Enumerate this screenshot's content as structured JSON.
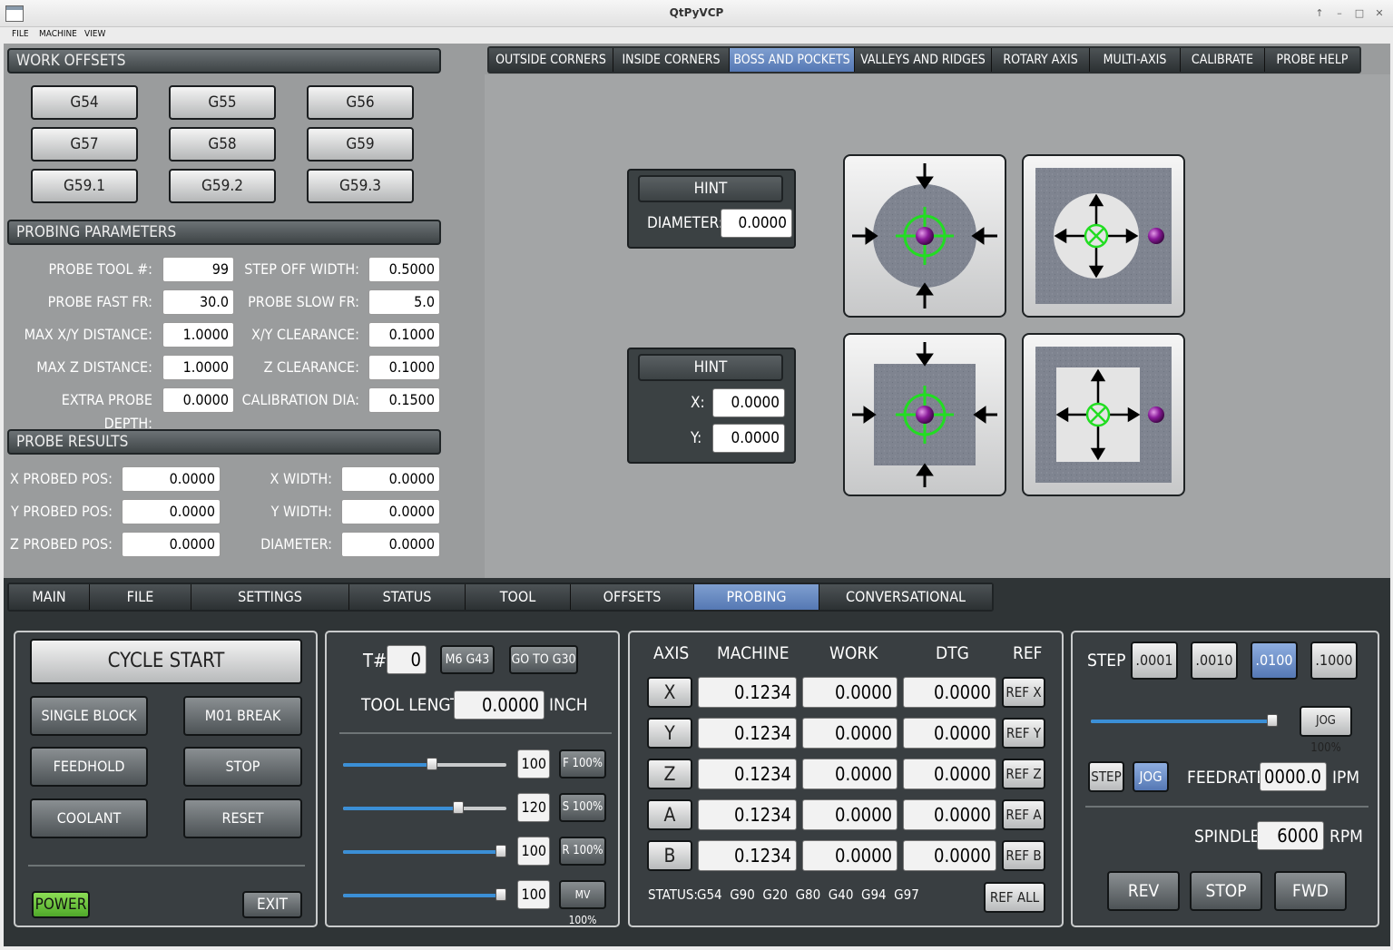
{
  "window": {
    "title": "QtPyVCP"
  },
  "menu": [
    "FILE",
    "MACHINE",
    "VIEW"
  ],
  "work_offsets": {
    "header": "WORK OFFSETS",
    "buttons": [
      "G54",
      "G55",
      "G56",
      "G57",
      "G58",
      "G59",
      "G59.1",
      "G59.2",
      "G59.3"
    ]
  },
  "probing_parameters": {
    "header": "PROBING PARAMETERS",
    "left": [
      {
        "label": "PROBE TOOL #:",
        "value": "99"
      },
      {
        "label": "PROBE FAST FR:",
        "value": "30.0"
      },
      {
        "label": "MAX X/Y DISTANCE:",
        "value": "1.0000"
      },
      {
        "label": "MAX Z DISTANCE:",
        "value": "1.0000"
      },
      {
        "label": "EXTRA PROBE DEPTH:",
        "value": "0.0000"
      }
    ],
    "right": [
      {
        "label": "STEP OFF WIDTH:",
        "value": "0.5000"
      },
      {
        "label": "PROBE SLOW FR:",
        "value": "5.0"
      },
      {
        "label": "X/Y CLEARANCE:",
        "value": "0.1000"
      },
      {
        "label": "Z CLEARANCE:",
        "value": "0.1000"
      },
      {
        "label": "CALIBRATION DIA:",
        "value": "0.1500"
      }
    ]
  },
  "probe_results": {
    "header": "PROBE RESULTS",
    "left": [
      {
        "label": "X PROBED POS:",
        "value": "0.0000"
      },
      {
        "label": "Y PROBED POS:",
        "value": "0.0000"
      },
      {
        "label": "Z PROBED POS:",
        "value": "0.0000"
      }
    ],
    "right": [
      {
        "label": "X WIDTH:",
        "value": "0.0000"
      },
      {
        "label": "Y WIDTH:",
        "value": "0.0000"
      },
      {
        "label": "DIAMETER:",
        "value": "0.0000"
      }
    ]
  },
  "probe_tabs": {
    "items": [
      "OUTSIDE CORNERS",
      "INSIDE CORNERS",
      "BOSS AND POCKETS",
      "VALLEYS AND RIDGES",
      "ROTARY AXIS",
      "MULTI-AXIS",
      "CALIBRATE",
      "PROBE HELP"
    ],
    "active": "BOSS AND POCKETS"
  },
  "hint_round": {
    "hint_label": "HINT",
    "diameter_label": "DIAMETER:",
    "diameter_value": "0.0000"
  },
  "hint_rect": {
    "hint_label": "HINT",
    "x_label": "X:",
    "x_value": "0.0000",
    "y_label": "Y:",
    "y_value": "0.0000"
  },
  "main_tabs": {
    "items": [
      "MAIN",
      "FILE",
      "SETTINGS",
      "STATUS",
      "TOOL",
      "OFFSETS",
      "PROBING",
      "CONVERSATIONAL"
    ],
    "active": "PROBING"
  },
  "program_controls": {
    "cycle_start": "CYCLE START",
    "single_block": "SINGLE BLOCK",
    "m01_break": "M01 BREAK",
    "feedhold": "FEEDHOLD",
    "stop": "STOP",
    "coolant": "COOLANT",
    "reset": "RESET",
    "power": "POWER",
    "exit": "EXIT"
  },
  "tool_panel": {
    "t_label": "T#",
    "t_value": "0",
    "m6_g43": "M6 G43",
    "go_to_g30": "GO TO G30",
    "tool_length_label": "TOOL LENGTH",
    "tool_length_value": "0.0000",
    "tool_length_unit": "INCH",
    "overrides": [
      {
        "value": "100",
        "button": "F 100%",
        "level": 0.55
      },
      {
        "value": "120",
        "button": "S 100%",
        "level": 0.72
      },
      {
        "value": "100",
        "button": "R 100%",
        "level": 1.0
      },
      {
        "value": "100",
        "button": "MV 100%",
        "level": 1.0
      }
    ]
  },
  "dro": {
    "headers": [
      "AXIS",
      "MACHINE",
      "WORK",
      "DTG",
      "REF"
    ],
    "rows": [
      {
        "axis": "X",
        "machine": "0.1234",
        "work": "0.0000",
        "dtg": "0.0000",
        "ref": "REF X"
      },
      {
        "axis": "Y",
        "machine": "0.1234",
        "work": "0.0000",
        "dtg": "0.0000",
        "ref": "REF Y"
      },
      {
        "axis": "Z",
        "machine": "0.1234",
        "work": "0.0000",
        "dtg": "0.0000",
        "ref": "REF Z"
      },
      {
        "axis": "A",
        "machine": "0.1234",
        "work": "0.0000",
        "dtg": "0.0000",
        "ref": "REF A"
      },
      {
        "axis": "B",
        "machine": "0.1234",
        "work": "0.0000",
        "dtg": "0.0000",
        "ref": "REF B"
      }
    ],
    "status_label": "STATUS:",
    "status_codes": "G54  G90  G20  G80  G40  G94  G97",
    "ref_all": "REF ALL"
  },
  "jog_panel": {
    "step_label": "STEP",
    "steps": [
      ".0001",
      ".0010",
      ".0100",
      ".1000"
    ],
    "active_step": ".0100",
    "jog_percent_button": "JOG 100%",
    "jog_level": 1.0,
    "mode_step": "STEP",
    "mode_jog": "JOG",
    "feedrate_label": "FEEDRATE",
    "feedrate_value": "0000.0",
    "feedrate_unit": "IPM",
    "spindle_label": "SPINDLE",
    "spindle_value": "6000",
    "spindle_unit": "RPM",
    "rev": "REV",
    "stop": "STOP",
    "fwd": "FWD"
  },
  "colors": {
    "accent_blue": "#5578b4",
    "power_green": "#6bcb3a",
    "target_green": "#22dd22",
    "probe_purple": "#8a1a9a"
  }
}
